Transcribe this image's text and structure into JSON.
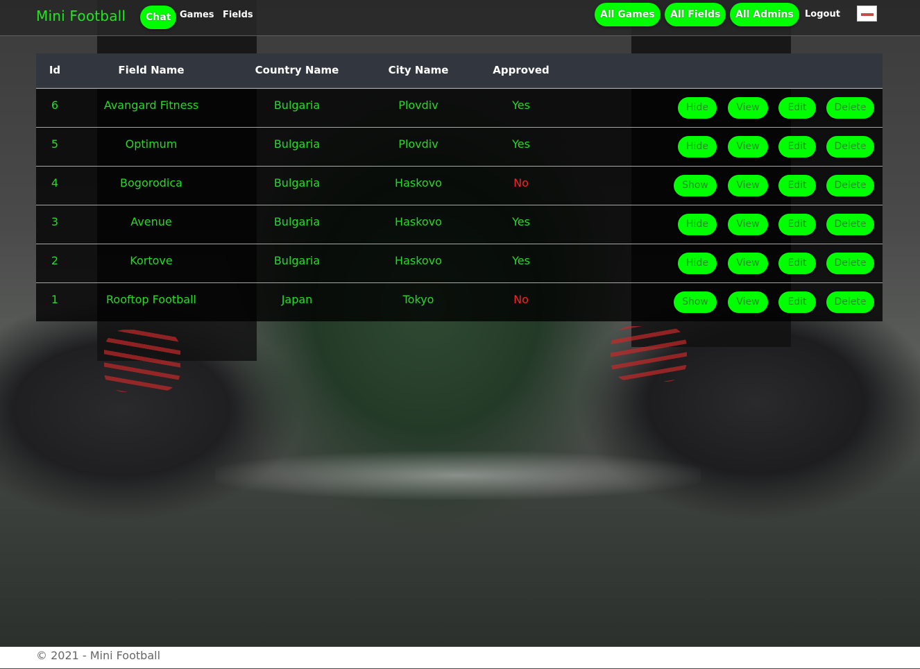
{
  "navbar": {
    "brand": "Mini Football",
    "chat_label": "Chat",
    "games_label": "Games",
    "fields_label": "Fields",
    "all_games_label": "All Games",
    "all_fields_label": "All Fields",
    "all_admins_label": "All Admins",
    "logout_label": "Logout"
  },
  "table": {
    "headers": [
      "Id",
      "Field Name",
      "Country Name",
      "City Name",
      "Approved"
    ],
    "rows": [
      {
        "id": "6",
        "field": "Avangard Fitness",
        "country": "Bulgaria",
        "city": "Plovdiv",
        "approved": "Yes",
        "toggle": "Hide",
        "view": "View",
        "edit": "Edit",
        "delete": "Delete"
      },
      {
        "id": "5",
        "field": "Optimum",
        "country": "Bulgaria",
        "city": "Plovdiv",
        "approved": "Yes",
        "toggle": "Hide",
        "view": "View",
        "edit": "Edit",
        "delete": "Delete"
      },
      {
        "id": "4",
        "field": "Bogorodica",
        "country": "Bulgaria",
        "city": "Haskovo",
        "approved": "No",
        "toggle": "Show",
        "view": "View",
        "edit": "Edit",
        "delete": "Delete"
      },
      {
        "id": "3",
        "field": "Avenue",
        "country": "Bulgaria",
        "city": "Haskovo",
        "approved": "Yes",
        "toggle": "Hide",
        "view": "View",
        "edit": "Edit",
        "delete": "Delete"
      },
      {
        "id": "2",
        "field": "Kortove",
        "country": "Bulgaria",
        "city": "Haskovo",
        "approved": "Yes",
        "toggle": "Hide",
        "view": "View",
        "edit": "Edit",
        "delete": "Delete"
      },
      {
        "id": "1",
        "field": "Rooftop Football",
        "country": "Japan",
        "city": "Tokyo",
        "approved": "No",
        "toggle": "Show",
        "view": "View",
        "edit": "Edit",
        "delete": "Delete"
      }
    ]
  },
  "footer": {
    "text": "© 2021 - Mini Football"
  },
  "colors": {
    "accent": "#00ff00",
    "yes": "#22dd22",
    "no": "#ff2020"
  }
}
